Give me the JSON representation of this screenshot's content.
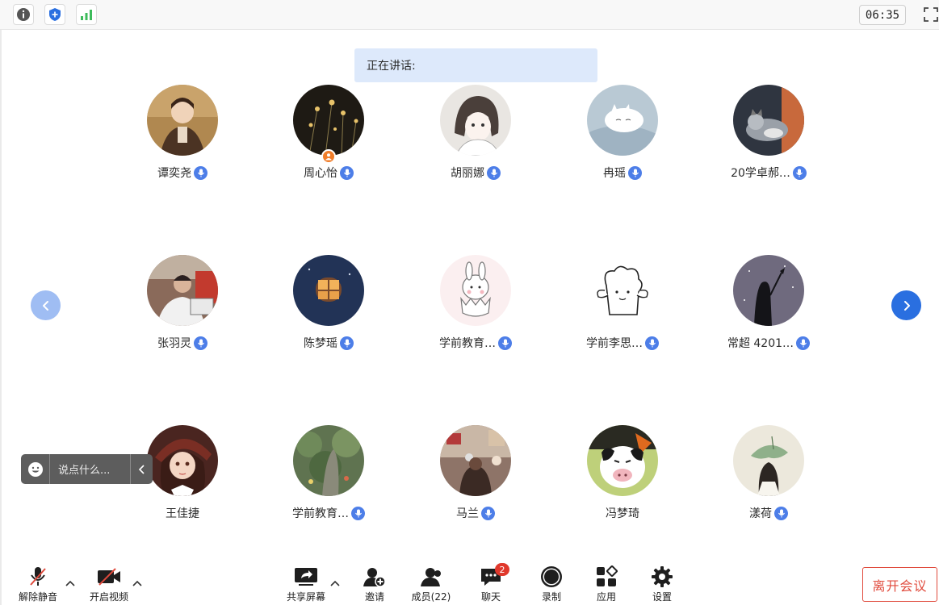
{
  "top": {
    "timer": "06:35",
    "icons": [
      "info-icon",
      "shield-icon",
      "signal-icon",
      "fullscreen-icon"
    ]
  },
  "speaking_label": "正在讲话:",
  "participants": [
    {
      "name": "谭奕尧",
      "mic": true
    },
    {
      "name": "周心怡",
      "mic": true,
      "host": true
    },
    {
      "name": "胡丽娜",
      "mic": true
    },
    {
      "name": "冉瑶",
      "mic": true
    },
    {
      "name": "20学卓郝…",
      "mic": true
    },
    {
      "name": "张羽灵",
      "mic": true
    },
    {
      "name": "陈梦瑶",
      "mic": true
    },
    {
      "name": "学前教育…",
      "mic": true
    },
    {
      "name": "学前李思…",
      "mic": true
    },
    {
      "name": "常超 4201…",
      "mic": true
    },
    {
      "name": "王佳捷",
      "mic": false
    },
    {
      "name": "学前教育…",
      "mic": true
    },
    {
      "name": "马兰",
      "mic": true
    },
    {
      "name": "冯梦琦",
      "mic": false
    },
    {
      "name": "漾荷",
      "mic": true
    }
  ],
  "chat": {
    "placeholder": "说点什么..."
  },
  "toolbar": {
    "unmute": "解除静音",
    "start_video": "开启视频",
    "share_screen": "共享屏幕",
    "invite": "邀请",
    "members": "成员(22)",
    "chat": "聊天",
    "chat_badge": "2",
    "record": "录制",
    "apps": "应用",
    "settings": "设置",
    "leave": "离开会议"
  },
  "colors": {
    "accent": "#2a6fe0",
    "leave": "#e04a3c",
    "mic": "#4d7ee8",
    "speaking_bg": "#dde9fb"
  }
}
